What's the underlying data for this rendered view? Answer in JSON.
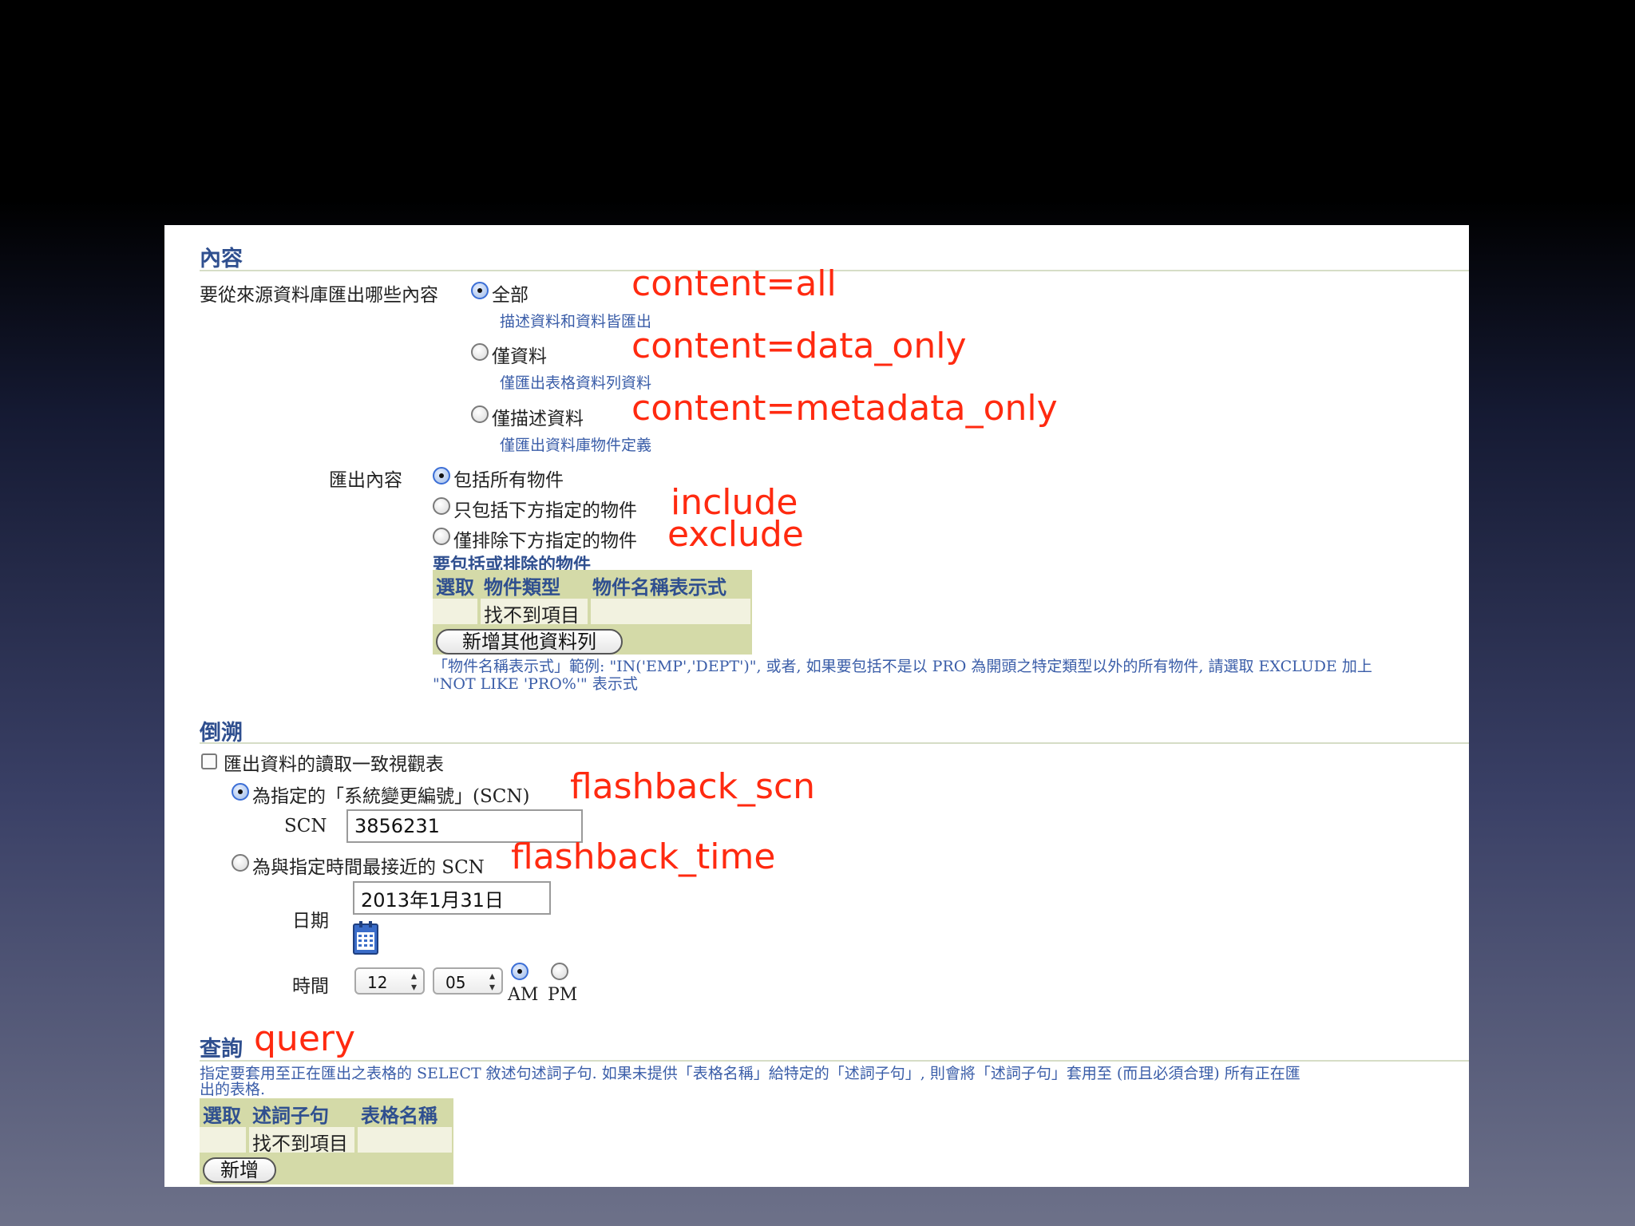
{
  "content": {
    "title": "內容",
    "question": "要從來源資料庫匯出哪些內容",
    "options": [
      {
        "label": "全部",
        "hint": "描述資料和資料皆匯出",
        "annotation": "content=all",
        "selected": true
      },
      {
        "label": "僅資料",
        "hint": "僅匯出表格資料列資料",
        "annotation": "content=data_only",
        "selected": false
      },
      {
        "label": "僅描述資料",
        "hint": "僅匯出資料庫物件定義",
        "annotation": "content=metadata_only",
        "selected": false
      }
    ],
    "export_label": "匯出內容",
    "export_options": [
      {
        "label": "包括所有物件",
        "annotation": "",
        "selected": true
      },
      {
        "label": "只包括下方指定的物件",
        "annotation": "include",
        "selected": false
      },
      {
        "label": "僅排除下方指定的物件",
        "annotation": "exclude",
        "selected": false
      }
    ],
    "objects_title": "要包括或排除的物件",
    "objects_table": {
      "headers": [
        "選取",
        "物件類型",
        "物件名稱表示式"
      ],
      "empty_text": "找不到項目",
      "add_button": "新增其他資料列"
    },
    "note_line1": "「物件名稱表示式」範例: \"IN('EMP','DEPT')\", 或者, 如果要包括不是以 PRO 為開頭之特定類型以外的所有物件, 請選取 EXCLUDE 加上",
    "note_line2": "\"NOT LIKE 'PRO%'\" 表示式"
  },
  "flashback": {
    "title": "倒溯",
    "checkbox_label": "匯出資料的讀取一致視觀表",
    "scn_option": {
      "label": "為指定的「系統變更編號」(SCN)",
      "annotation": "flashback_scn",
      "selected": true
    },
    "scn_label": "SCN",
    "scn_value": "3856231",
    "time_option": {
      "label": "為與指定時間最接近的 SCN",
      "annotation": "flashback_time",
      "selected": false
    },
    "date_label": "日期",
    "date_value": "2013年1月31日",
    "time_label": "時間",
    "hour": "12",
    "minute": "05",
    "am_label": "AM",
    "pm_label": "PM"
  },
  "query": {
    "title": "查詢",
    "annotation": "query",
    "desc_line1": "指定要套用至正在匯出之表格的 SELECT 敘述句述詞子句. 如果未提供「表格名稱」給特定的「述詞子句」, 則會將「述詞子句」套用至 (而且必須合理) 所有正在匯",
    "desc_line2": "出的表格.",
    "table": {
      "headers": [
        "選取",
        "述詞子句",
        "表格名稱"
      ],
      "empty_text": "找不到項目",
      "add_button": "新增"
    }
  }
}
